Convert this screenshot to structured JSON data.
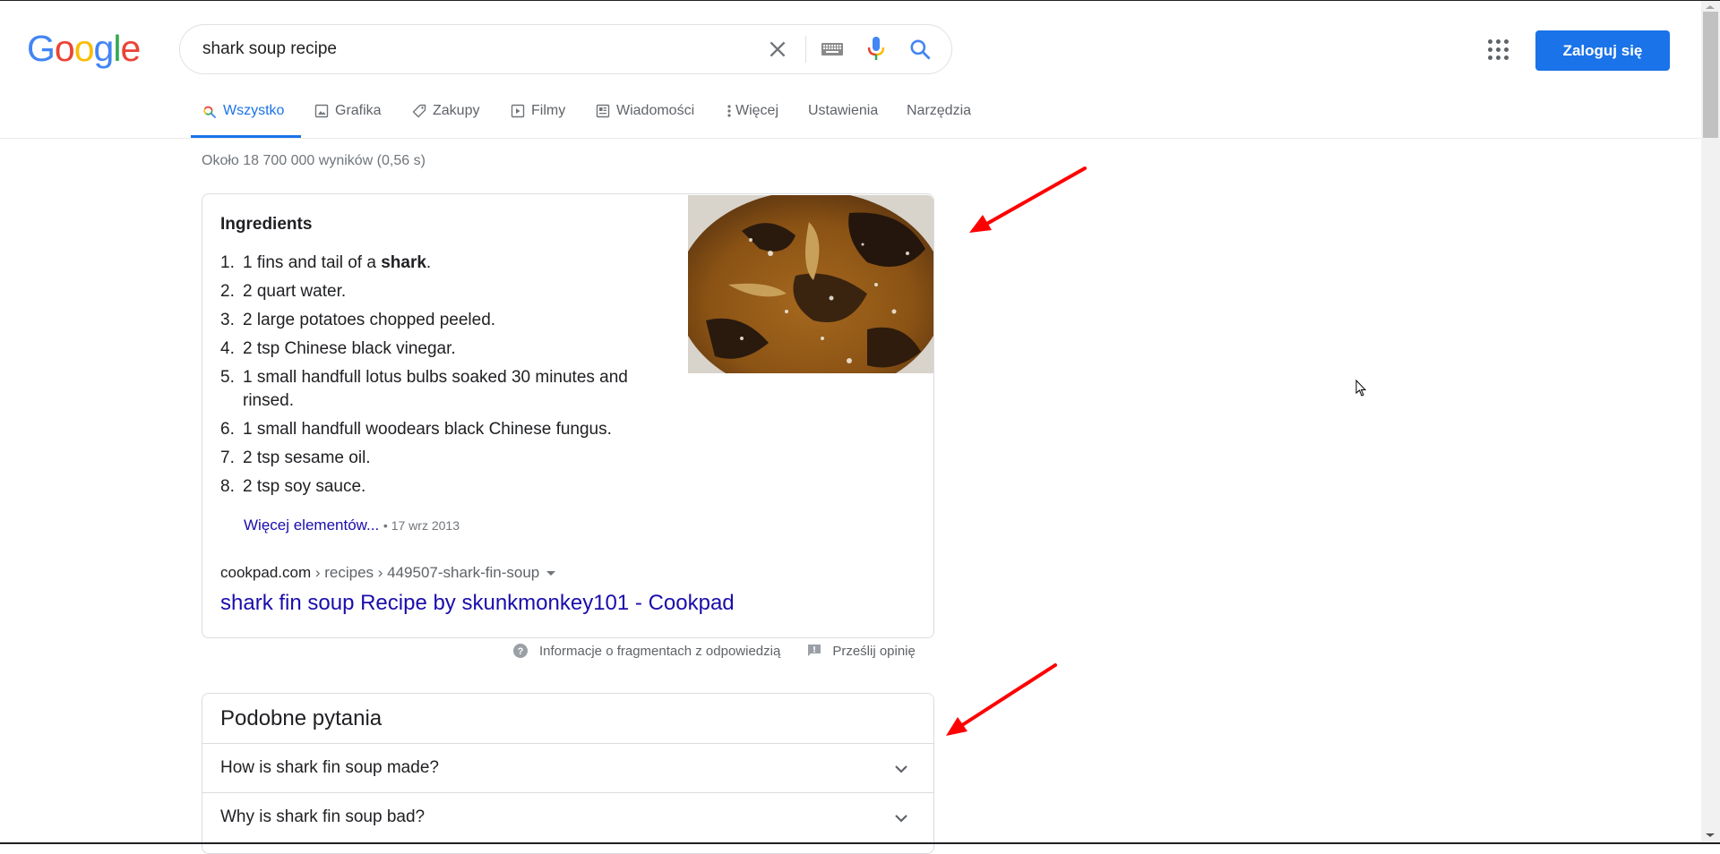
{
  "header": {
    "logo_letters": [
      "G",
      "o",
      "o",
      "g",
      "l",
      "e"
    ],
    "search": {
      "value": "shark soup recipe",
      "placeholder": ""
    },
    "icons": {
      "clear": "close-icon",
      "keyboard": "keyboard-icon",
      "voice": "microphone-icon",
      "search": "search-icon",
      "apps": "apps-grid-icon"
    },
    "signin_label": "Zaloguj się",
    "colors": {
      "accent": "#1a73e8",
      "link": "#1a0dab"
    }
  },
  "tabs": [
    {
      "label": "Wszystko",
      "icon": "search-icon",
      "active": true
    },
    {
      "label": "Grafika",
      "icon": "image-icon",
      "active": false
    },
    {
      "label": "Zakupy",
      "icon": "tag-icon",
      "active": false
    },
    {
      "label": "Filmy",
      "icon": "play-icon",
      "active": false
    },
    {
      "label": "Wiadomości",
      "icon": "news-icon",
      "active": false
    },
    {
      "label": "Więcej",
      "icon": "more-vert-icon",
      "active": false
    },
    {
      "label": "Ustawienia",
      "icon": "",
      "active": false
    },
    {
      "label": "Narzędzia",
      "icon": "",
      "active": false
    }
  ],
  "result_stats": "Około 18 700 000 wyników (0,56 s)",
  "featured_snippet": {
    "title": "Ingredients",
    "items": [
      {
        "num": "1.",
        "pre": "1 fins and tail of a ",
        "bold": "shark",
        "post": "."
      },
      {
        "num": "2.",
        "pre": "2 quart water.",
        "bold": "",
        "post": ""
      },
      {
        "num": "3.",
        "pre": "2 large potatoes chopped peeled.",
        "bold": "",
        "post": ""
      },
      {
        "num": "4.",
        "pre": "2 tsp Chinese black vinegar.",
        "bold": "",
        "post": ""
      },
      {
        "num": "5.",
        "pre": "1 small handfull lotus bulbs soaked 30 minutes and rinsed.",
        "bold": "",
        "post": ""
      },
      {
        "num": "6.",
        "pre": "1 small handfull woodears black Chinese fungus.",
        "bold": "",
        "post": ""
      },
      {
        "num": "7.",
        "pre": "2 tsp sesame oil.",
        "bold": "",
        "post": ""
      },
      {
        "num": "8.",
        "pre": "2 tsp soy sauce.",
        "bold": "",
        "post": ""
      }
    ],
    "more_label": "Więcej elementów...",
    "bullet": "•",
    "date": "17 wrz 2013",
    "cite_domain": "cookpad.com",
    "cite_path": " › recipes › 449507-shark-fin-soup",
    "result_title": "shark fin soup Recipe by skunkmonkey101 - Cookpad",
    "image_alt": "shark fin soup photo"
  },
  "snippet_footer": {
    "about_label": "Informacje o fragmentach z odpowiedzią",
    "feedback_label": "Prześlij opinię"
  },
  "people_also_ask": {
    "title": "Podobne pytania",
    "questions": [
      "How is shark fin soup made?",
      "Why is shark fin soup bad?"
    ]
  },
  "annotations": {
    "arrow_color": "#ff0000"
  }
}
